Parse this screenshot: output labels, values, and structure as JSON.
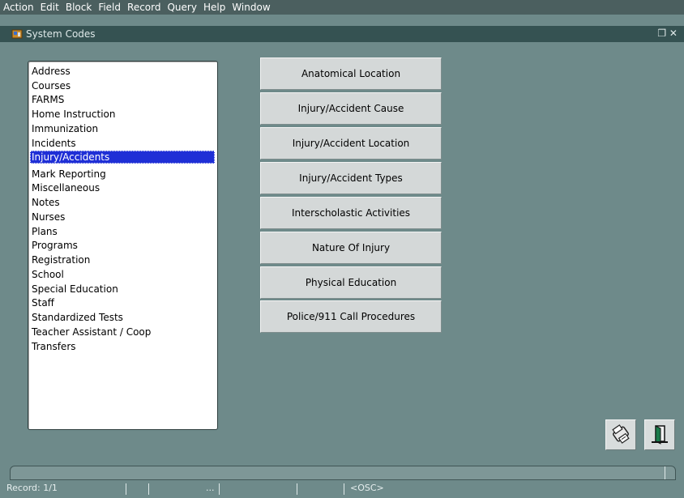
{
  "menubar": {
    "items": [
      "Action",
      "Edit",
      "Block",
      "Field",
      "Record",
      "Query",
      "Help",
      "Window"
    ]
  },
  "window": {
    "title": "System Codes"
  },
  "code_list": {
    "items": [
      "Address",
      "Courses",
      "FARMS",
      "Home Instruction",
      "Immunization",
      "Incidents",
      "Injury/Accidents",
      "Mark Reporting",
      "Miscellaneous",
      "Notes",
      "Nurses",
      "Plans",
      "Programs",
      "Registration",
      "School",
      "Special Education",
      "Staff",
      "Standardized Tests",
      "Teacher Assistant / Coop",
      "Transfers"
    ],
    "selected": "Injury/Accidents"
  },
  "code_buttons": [
    "Anatomical Location",
    "Injury/Accident Cause",
    "Injury/Accident Location",
    "Injury/Accident Types",
    "Interscholastic Activities",
    "Nature Of Injury",
    "Physical Education",
    "Police/911 Call Procedures"
  ],
  "toolbar": {
    "print_icon": "printer-icon",
    "exit_icon": "exit-door-icon"
  },
  "statusbar": {
    "record": "Record: 1/1",
    "ellipsis": "...",
    "mode": "<OSC>"
  },
  "colors": {
    "background": "#6e8a8a",
    "selection": "#1f2fd6",
    "titlebar": "#355252"
  }
}
